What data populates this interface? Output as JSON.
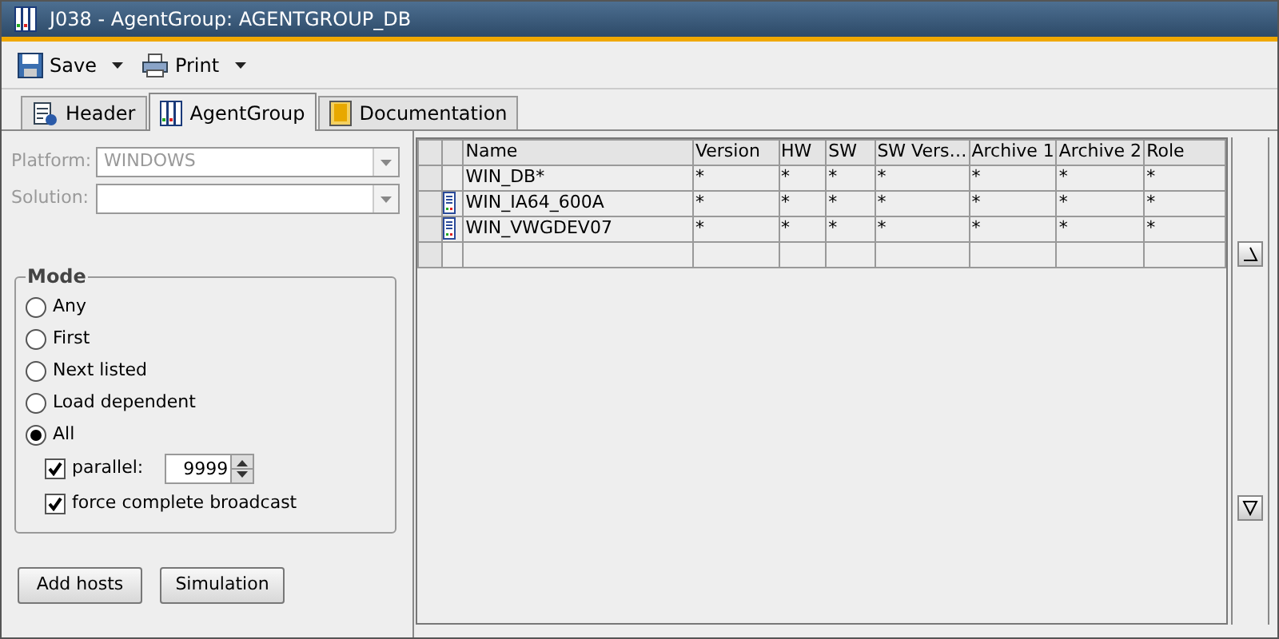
{
  "window": {
    "title": "J038 - AgentGroup: AGENTGROUP_DB"
  },
  "toolbar": [
    {
      "label": "Save",
      "kind": "save"
    },
    {
      "label": "Print",
      "kind": "print"
    }
  ],
  "tabs": [
    {
      "label": "Header",
      "kind": "header",
      "selected": false
    },
    {
      "label": "AgentGroup",
      "kind": "agentgroup",
      "selected": true
    },
    {
      "label": "Documentation",
      "kind": "documentation",
      "selected": false
    }
  ],
  "fields": [
    {
      "label": "Platform:",
      "value": "WINDOWS",
      "disabled": true
    },
    {
      "label": "Solution:",
      "disabled": true
    }
  ],
  "mode": {
    "title": "Mode",
    "options": [
      {
        "label": "Any",
        "selected": false
      },
      {
        "label": "First",
        "selected": false
      },
      {
        "label": "Next listed",
        "selected": false
      },
      {
        "label": "Load dependent",
        "selected": false
      },
      {
        "label": "All",
        "selected": true
      }
    ],
    "parallel": {
      "label": "parallel:",
      "checked": true,
      "value": "9999"
    },
    "broadcast": {
      "label": "force complete broadcast",
      "checked": true
    }
  },
  "buttons": [
    "Add hosts",
    "Simulation"
  ],
  "table": {
    "columns": [
      "Name",
      "Version",
      "HW",
      "SW",
      "SW Vers…",
      "Archive 1",
      "Archive 2",
      "Role"
    ],
    "rows": [
      {
        "host_icon": false,
        "cells": [
          "WIN_DB*",
          "*",
          "*",
          "*",
          "*",
          "*",
          "*",
          "*"
        ]
      },
      {
        "host_icon": true,
        "cells": [
          "WIN_IA64_600A",
          "*",
          "*",
          "*",
          "*",
          "*",
          "*",
          "*"
        ]
      },
      {
        "host_icon": true,
        "cells": [
          "WIN_VWGDEV07",
          "*",
          "*",
          "*",
          "*",
          "*",
          "*",
          "*"
        ]
      },
      {
        "host_icon": false,
        "cells": []
      }
    ]
  }
}
